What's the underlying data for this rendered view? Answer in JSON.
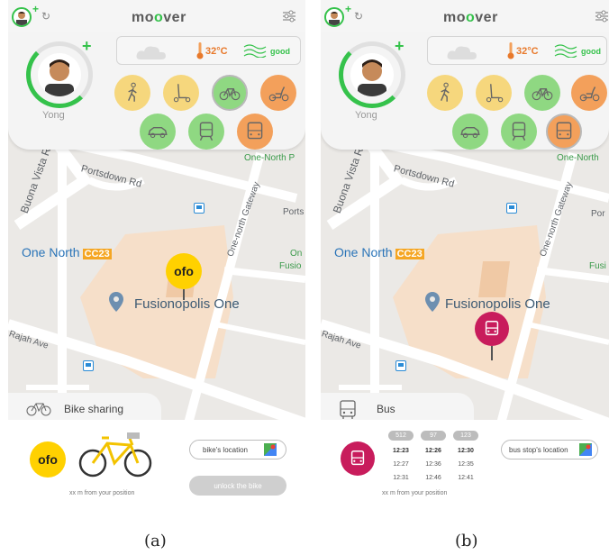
{
  "colors": {
    "brand_green": "#35c24b",
    "yellow_mode": "#f6d77d",
    "green_mode": "#8fd882",
    "orange_mode": "#f3a05b",
    "ofo_yellow": "#ffd100",
    "bus_magenta": "#c81c5c"
  },
  "panels": [
    {
      "id": "a",
      "app_title_pre": "mo",
      "app_title_o": "o",
      "app_title_post": "ver",
      "user_name": "Yong",
      "weather": {
        "icon": "cloud-icon",
        "temperature": "32°C",
        "air_quality": "good"
      },
      "modes": [
        {
          "name": "walk",
          "icon": "walking-icon",
          "color": "yellow",
          "selected": false
        },
        {
          "name": "scooter",
          "icon": "kick-scooter-icon",
          "color": "yellow",
          "selected": false
        },
        {
          "name": "bike",
          "icon": "bicycle-icon",
          "color": "green",
          "selected": true
        },
        {
          "name": "motor-scooter",
          "icon": "motor-scooter-icon",
          "color": "orange",
          "selected": false
        },
        {
          "name": "car",
          "icon": "car-icon",
          "color": "green",
          "selected": false
        },
        {
          "name": "train",
          "icon": "train-icon",
          "color": "green",
          "selected": false
        },
        {
          "name": "bus",
          "icon": "bus-icon",
          "color": "orange",
          "selected": false
        }
      ],
      "map": {
        "streets": [
          "Buona Vista Rd",
          "Portsdown Rd",
          "One-north Gateway",
          "Rajah Ave",
          "One-North P",
          "Ports",
          "On",
          "Fusio"
        ],
        "station": "One North",
        "station_code": "CC23",
        "poi": "Fusionopolis One",
        "pin_logo": "ofo"
      },
      "sheet": {
        "tab_label": "Bike sharing",
        "logo_text": "ofo",
        "location_button": "bike's location",
        "action_button": "unlock the bike",
        "distance": "xx m from your position"
      },
      "caption": "(a)"
    },
    {
      "id": "b",
      "app_title_pre": "mo",
      "app_title_o": "o",
      "app_title_post": "ver",
      "user_name": "Yong",
      "weather": {
        "icon": "cloud-icon",
        "temperature": "32°C",
        "air_quality": "good"
      },
      "modes": [
        {
          "name": "walk",
          "icon": "walking-icon",
          "color": "yellow",
          "selected": false
        },
        {
          "name": "scooter",
          "icon": "kick-scooter-icon",
          "color": "yellow",
          "selected": false
        },
        {
          "name": "bike",
          "icon": "bicycle-icon",
          "color": "green",
          "selected": false
        },
        {
          "name": "motor-scooter",
          "icon": "motor-scooter-icon",
          "color": "orange",
          "selected": false
        },
        {
          "name": "car",
          "icon": "car-icon",
          "color": "green",
          "selected": false
        },
        {
          "name": "train",
          "icon": "train-icon",
          "color": "green",
          "selected": false
        },
        {
          "name": "bus",
          "icon": "bus-icon",
          "color": "orange",
          "selected": true
        }
      ],
      "map": {
        "streets": [
          "Buona Vista Rd",
          "Portsdown Rd",
          "One-north Gateway",
          "Rajah Ave",
          "One-North",
          "Por",
          "Fusi"
        ],
        "station": "One North",
        "station_code": "CC23",
        "poi": "Fusionopolis One"
      },
      "sheet": {
        "tab_label": "Bus",
        "location_button": "bus stop's location",
        "distance": "xx m from your position",
        "bus_routes": [
          {
            "number": "512",
            "times": [
              "12:23",
              "12:27",
              "12:31"
            ]
          },
          {
            "number": "97",
            "times": [
              "12:26",
              "12:36",
              "12:46"
            ]
          },
          {
            "number": "123",
            "times": [
              "12:30",
              "12:35",
              "12:41"
            ]
          }
        ]
      },
      "caption": "(b)"
    }
  ]
}
